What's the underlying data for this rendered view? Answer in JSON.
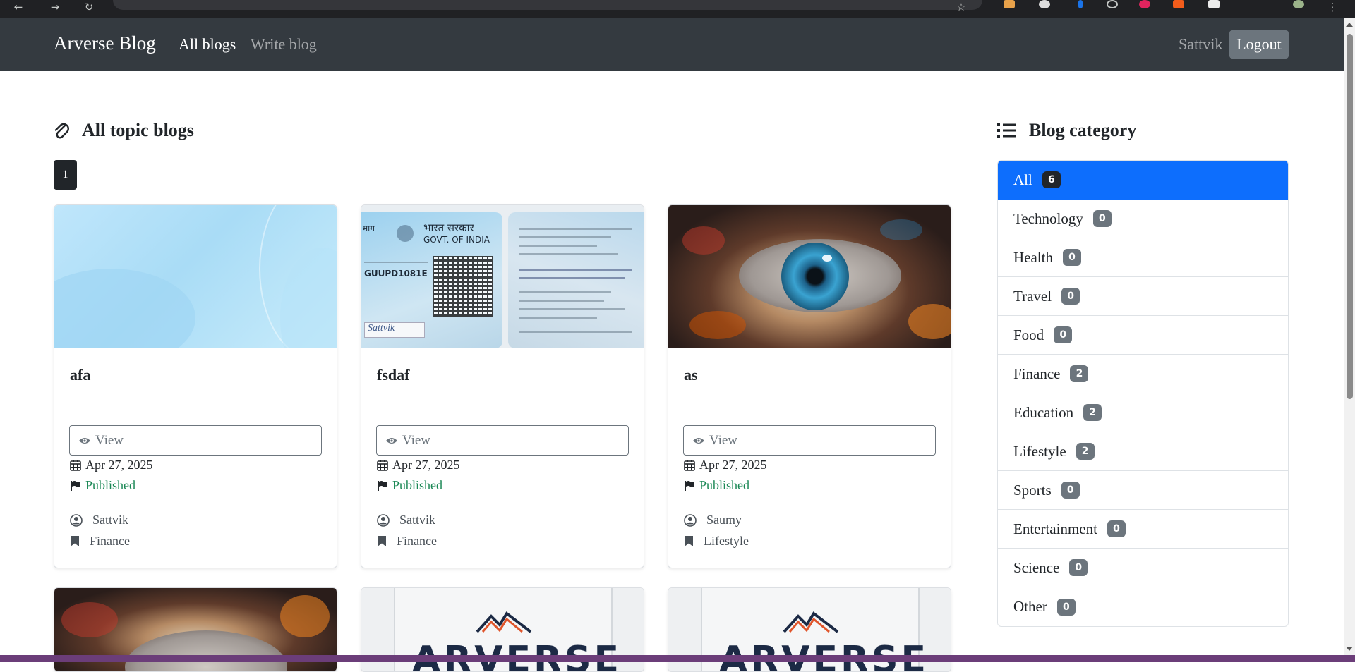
{
  "navbar": {
    "brand": "Arverse Blog",
    "links": [
      "All blogs",
      "Write blog"
    ],
    "user": "Sattvik",
    "logout": "Logout"
  },
  "main": {
    "heading": "All topic blogs",
    "page_number": "1",
    "cards": [
      {
        "title": "afa",
        "view_label": "View",
        "date": "Apr 27, 2025",
        "status": "Published",
        "author": "Sattvik",
        "category": "Finance",
        "image": "soft-blue-abstract"
      },
      {
        "title": "fsdaf",
        "view_label": "View",
        "date": "Apr 27, 2025",
        "status": "Published",
        "author": "Sattvik",
        "category": "Finance",
        "image": "pan-card-scan"
      },
      {
        "title": "as",
        "view_label": "View",
        "date": "Apr 27, 2025",
        "status": "Published",
        "author": "Saumy",
        "category": "Lifestyle",
        "image": "colorful-eye"
      }
    ],
    "partial_cards": [
      {
        "image": "colorful-eye"
      },
      {
        "image": "arverse-logo",
        "logo_text": "ARVERSE"
      },
      {
        "image": "arverse-logo",
        "logo_text": "ARVERSE"
      }
    ]
  },
  "sidebar": {
    "heading": "Blog category",
    "categories": [
      {
        "label": "All",
        "count": "6",
        "active": true
      },
      {
        "label": "Technology",
        "count": "0"
      },
      {
        "label": "Health",
        "count": "0"
      },
      {
        "label": "Travel",
        "count": "0"
      },
      {
        "label": "Food",
        "count": "0"
      },
      {
        "label": "Finance",
        "count": "2"
      },
      {
        "label": "Education",
        "count": "2"
      },
      {
        "label": "Lifestyle",
        "count": "2"
      },
      {
        "label": "Sports",
        "count": "0"
      },
      {
        "label": "Entertainment",
        "count": "0"
      },
      {
        "label": "Science",
        "count": "0"
      },
      {
        "label": "Other",
        "count": "0"
      }
    ]
  },
  "pan_card": {
    "line_hindi": "भारत सरकार",
    "govt": "GOVT. OF INDIA",
    "pan": "GUUPD1081E",
    "signature": "Sattvik"
  },
  "colors": {
    "navbar_bg": "#343a40",
    "active_blue": "#0d6efd",
    "published_green": "#198754",
    "badge_gray": "#6c757d"
  }
}
